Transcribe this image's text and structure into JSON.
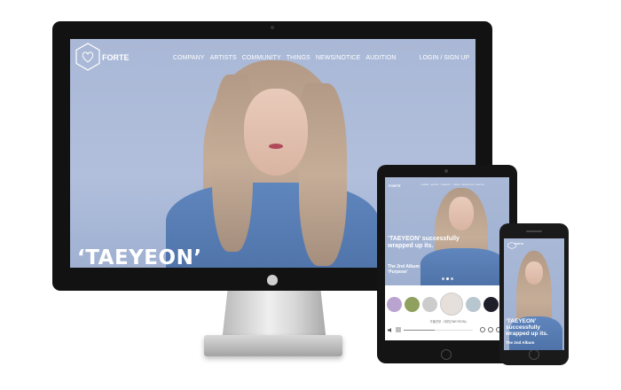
{
  "desktop": {
    "brand": {
      "name": "FORTE"
    },
    "nav": {
      "items": [
        "COMPANY",
        "ARTISTS",
        "COMMUNITY",
        "THINGS",
        "NEWS/NOTICE",
        "AUDITION"
      ],
      "login": "LOGIN / SIGN UP"
    },
    "hero": {
      "title": "‘TAEYEON’"
    }
  },
  "tablet": {
    "brand": "FORTE",
    "nav_items": [
      "COMPANY",
      "ARTISTS",
      "COMMUNITY",
      "THINGS",
      "NEWS/NOTICE",
      "AUDITION"
    ],
    "hero": {
      "headline": "‘TAEYEON’ successfully wrapped up its.",
      "sub_line1": "The 2nd Album",
      "sub_line2": "‘Purpose’"
    },
    "player": {
      "track": "가을안부 - 태연(TAEYEON)",
      "progress": 0.45
    }
  },
  "phone": {
    "brand": "FORTE",
    "hero": {
      "headline": "‘TAEYEON’ successfully wrapped up its.",
      "sub": "The 2nd Album"
    }
  },
  "colors": {
    "sky": "#a9b8d6",
    "shirt": "#5f86bd",
    "bezel": "#121212"
  }
}
